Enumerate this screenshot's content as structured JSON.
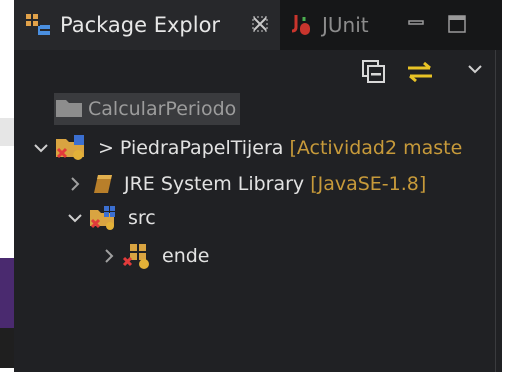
{
  "tabs": [
    {
      "label": "Package Explor",
      "active": true
    },
    {
      "label": "JUnit",
      "active": false
    }
  ],
  "toolbar": {
    "icons": [
      "collapse-all-icon",
      "link-with-editor-icon",
      "view-menu-icon"
    ]
  },
  "tree": {
    "closed_project": "CalcularPeriodo",
    "project": {
      "prefix": ">",
      "name": "PiedraPapelTijera",
      "decoration": "[Actividad2 maste"
    },
    "library": {
      "name": "JRE System Library",
      "decoration": "[JavaSE-1.8]"
    },
    "src": {
      "name": "src"
    },
    "package": {
      "name": "ende"
    }
  },
  "colors": {
    "background": "#202124",
    "tab_active": "#27282b",
    "text": "#e2e2e2",
    "decoration": "#c79a3a",
    "sync_icon": "#e8c326"
  }
}
